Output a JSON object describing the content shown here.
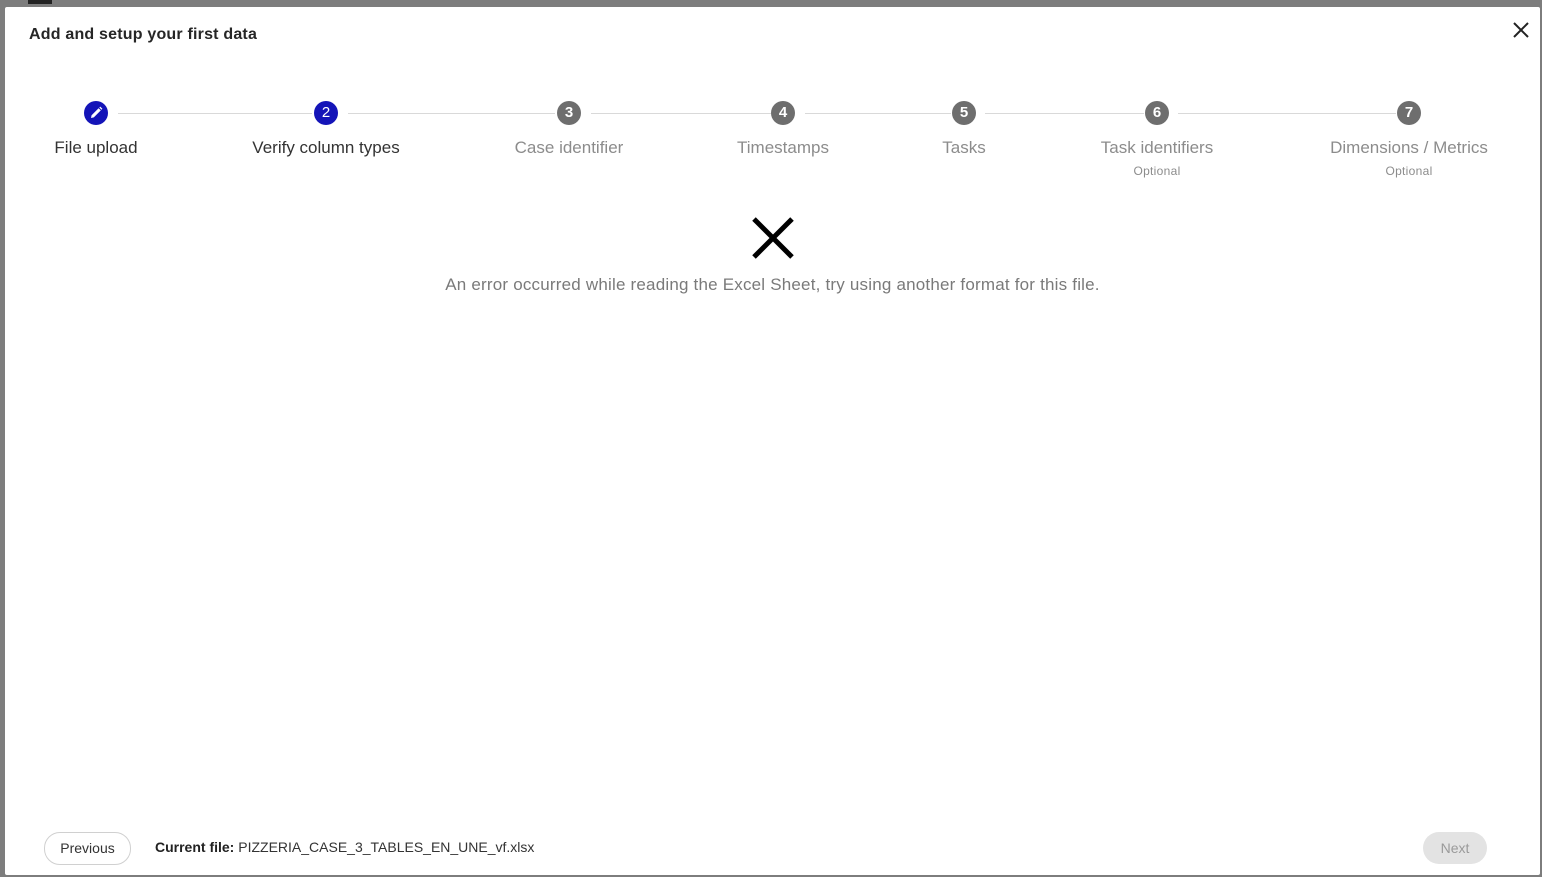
{
  "modal": {
    "title": "Add and setup your first data",
    "close_icon": "close-icon"
  },
  "steps": [
    {
      "number": "",
      "label": "File upload",
      "sublabel": "",
      "state": "completed",
      "icon": "pencil-icon"
    },
    {
      "number": "2",
      "label": "Verify column types",
      "sublabel": "",
      "state": "active"
    },
    {
      "number": "3",
      "label": "Case identifier",
      "sublabel": "",
      "state": "pending"
    },
    {
      "number": "4",
      "label": "Timestamps",
      "sublabel": "",
      "state": "pending"
    },
    {
      "number": "5",
      "label": "Tasks",
      "sublabel": "",
      "state": "pending"
    },
    {
      "number": "6",
      "label": "Task identifiers",
      "sublabel": "Optional",
      "state": "pending"
    },
    {
      "number": "7",
      "label": "Dimensions / Metrics",
      "sublabel": "Optional",
      "state": "pending"
    }
  ],
  "error": {
    "icon": "error-x-icon",
    "message": "An error occurred while reading the Excel Sheet, try using another format for this file."
  },
  "footer": {
    "previous_label": "Previous",
    "current_file_label": "Current file:",
    "current_file_name": "PIZZERIA_CASE_3_TABLES_EN_UNE_vf.xlsx",
    "next_label": "Next"
  },
  "colors": {
    "active_step": "#1414b8",
    "pending_step": "#6e6e6e",
    "next_disabled_bg": "#e3e3e3"
  }
}
